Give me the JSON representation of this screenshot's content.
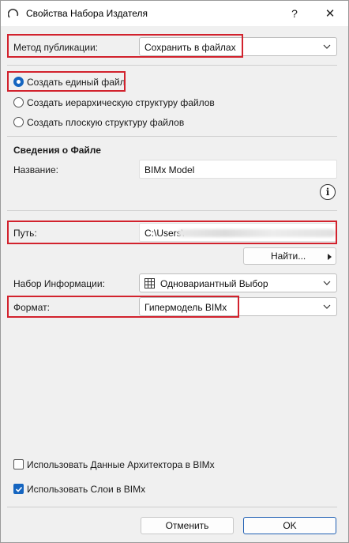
{
  "window": {
    "title": "Свойства Набора Издателя",
    "help_label": "?",
    "close_label": "✕"
  },
  "publish_method": {
    "label": "Метод публикации:",
    "value": "Сохранить в файлах"
  },
  "file_structure": {
    "options": [
      {
        "label": "Создать единый файл",
        "checked": true
      },
      {
        "label": "Создать иерархическую структуру файлов",
        "checked": false
      },
      {
        "label": "Создать плоскую структуру файлов",
        "checked": false
      }
    ]
  },
  "file_info": {
    "heading": "Сведения о Файле",
    "name_label": "Название:",
    "name_value": "BIMx Model",
    "info_icon": "info-icon",
    "path_label": "Путь:",
    "path_value": "C:\\Users\\",
    "browse_label": "Найти..."
  },
  "info_set": {
    "label": "Набор Информации:",
    "value": "Одновариантный Выбор",
    "icon": "table-icon"
  },
  "format": {
    "label": "Формат:",
    "value": "Гипермодель BIMx"
  },
  "options": {
    "architect_data": {
      "label": "Использовать Данные Архитектора в BIMx",
      "checked": false
    },
    "layers": {
      "label": "Использовать Слои в BIMx",
      "checked": true
    }
  },
  "footer": {
    "cancel_label": "Отменить",
    "ok_label": "OK"
  },
  "colors": {
    "highlight": "#d2222d",
    "accent": "#1565c0"
  }
}
